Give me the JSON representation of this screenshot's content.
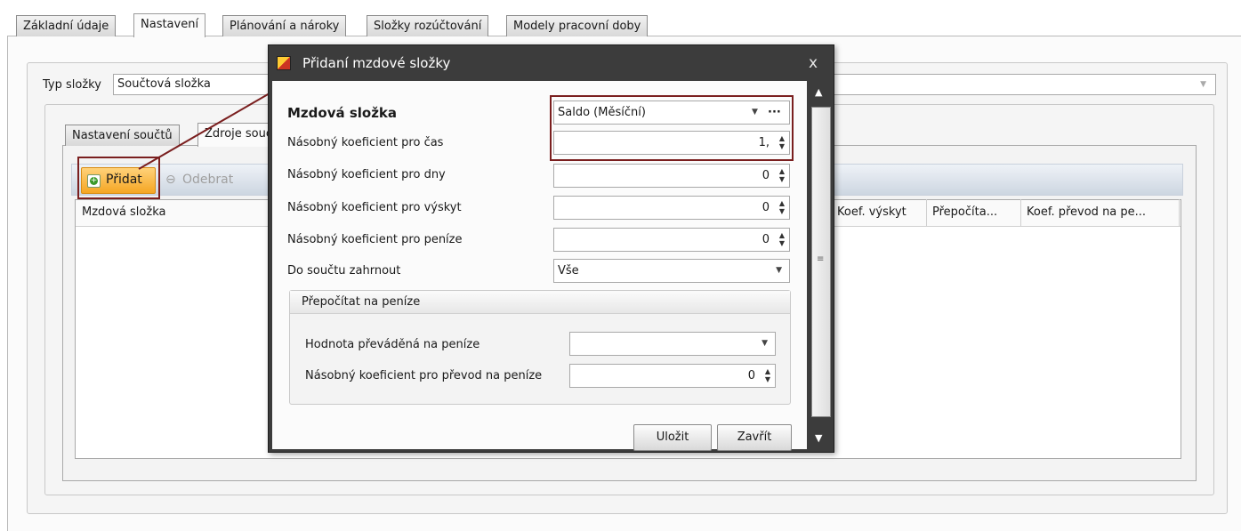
{
  "tabs": [
    "Základní údaje",
    "Nastavení",
    "Plánování a nároky",
    "Složky rozúčtování",
    "Modely pracovní doby"
  ],
  "type_field": {
    "label": "Typ složky",
    "value": "Součtová složka"
  },
  "inner_tabs": [
    "Nastavení součtů",
    "Zdroje součtů"
  ],
  "toolbar": {
    "add": "Přidat",
    "remove": "Odebrat"
  },
  "grid_columns": {
    "first": "Mzdová složka",
    "koef_vyskyt": "Koef. výskyt",
    "prepocita": "Přepočíta...",
    "koef_prevod": "Koef. převod na pe..."
  },
  "dialog": {
    "title": "Přidaní mzdové složky",
    "close": "x",
    "mzdova_label": "Mzdová složka",
    "mzdova_value": "Saldo (Měsíční)",
    "mzdova_ellipsis": "···",
    "cas_label": "Násobný koeficient pro čas",
    "cas_value": "1,",
    "dny_label": "Násobný koeficient pro dny",
    "dny_value": "0",
    "vyskyt_label": "Násobný koeficient pro výskyt",
    "vyskyt_value": "0",
    "penize_label": "Násobný koeficient pro peníze",
    "penize_value": "0",
    "soucet_label": "Do součtu zahrnout",
    "soucet_value": "Vše",
    "group_title": "Přepočítat na peníze",
    "hodnota_label": "Hodnota převáděná na peníze",
    "hodnota_value": "",
    "prevod_label": "Násobný koeficient pro převod na peníze",
    "prevod_value": "0",
    "save": "Uložit",
    "close_btn": "Zavřít"
  },
  "colors": {
    "dialog_frame": "#3c3c3c",
    "highlight": "#7a1f1f",
    "add_button": "#f5a623"
  }
}
